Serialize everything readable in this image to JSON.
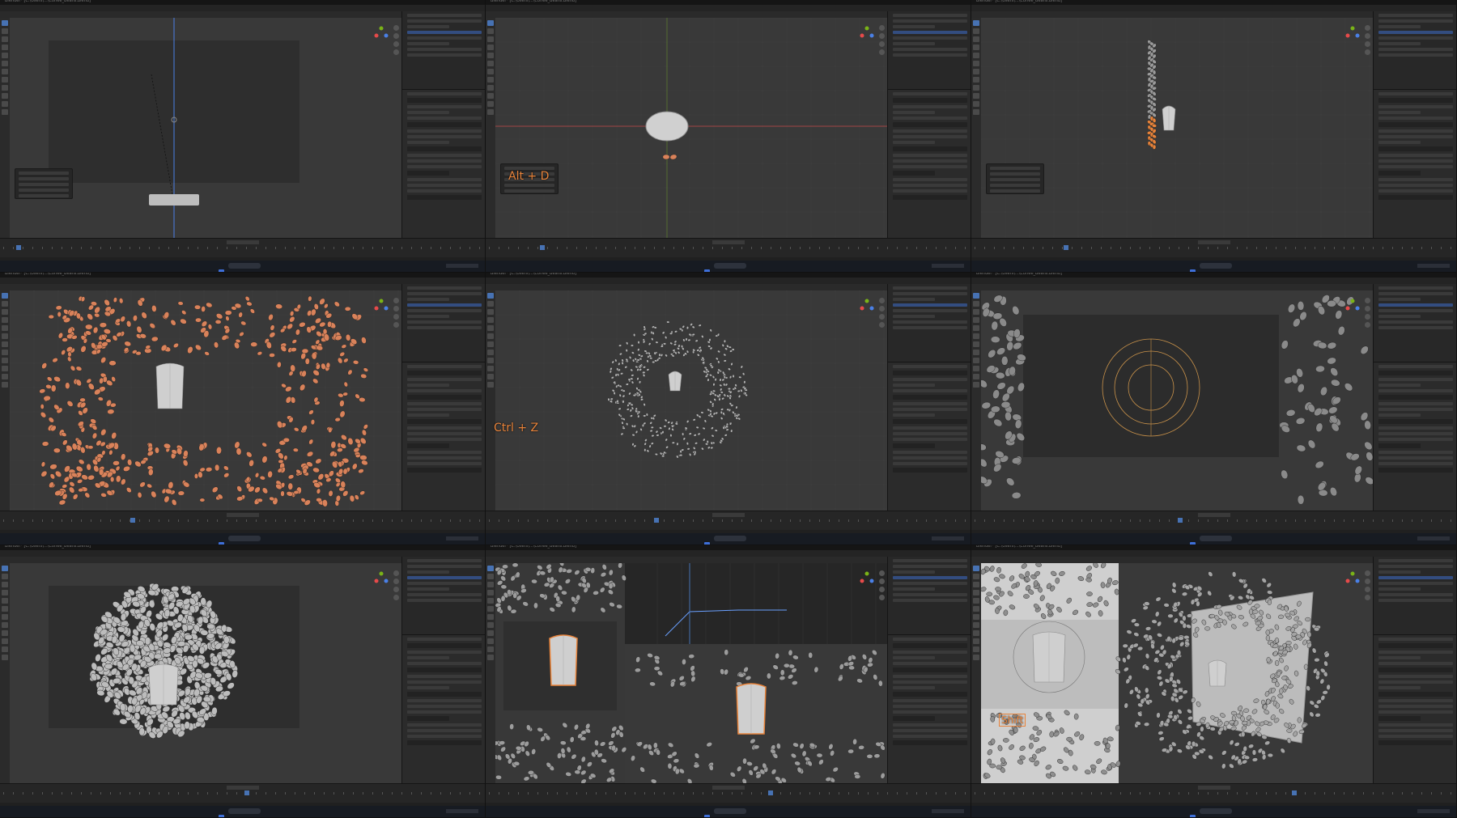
{
  "app": {
    "title_text": "Blender* [C:\\Users\\...\\Coffee_Beans.blend]"
  },
  "menu": [
    "File",
    "Edit",
    "Render",
    "Window",
    "Help"
  ],
  "panels": [
    {
      "id": "p1",
      "title": "Blender* [C:\\Users\\...\\Coffee_Beans.blend]",
      "shortcut": ""
    },
    {
      "id": "p2",
      "title": "Blender* [C:\\Users\\...\\Coffee_Beans.blend]",
      "shortcut": "Alt + D"
    },
    {
      "id": "p3",
      "title": "Blender* [C:\\Users\\...\\Coffee_Beans.blend]",
      "shortcut": ""
    },
    {
      "id": "p4",
      "title": "Blender* [C:\\Users\\...\\Coffee_Beans.blend]",
      "shortcut": ""
    },
    {
      "id": "p5",
      "title": "Blender* [C:\\Users\\...\\Coffee_Beans.blend]",
      "shortcut": "Ctrl + Z"
    },
    {
      "id": "p6",
      "title": "Blender* [C:\\Users\\...\\Coffee_Beans.blend]",
      "shortcut": ""
    },
    {
      "id": "p7",
      "title": "Blender* [C:\\Users\\...\\Coffee_Beans.blend]",
      "shortcut": ""
    },
    {
      "id": "p8",
      "title": "Blender* [C:\\Users\\...\\Coffee_Beans.blend]",
      "shortcut": ""
    },
    {
      "id": "p9",
      "title": "Blender* [C:\\Users\\...\\Coffee_Beans.blend]",
      "shortcut": "Shift"
    }
  ],
  "colors": {
    "accent": "#4772b3",
    "selection_orange": "#e8833a",
    "bean_copper": "#d9825a",
    "bean_gray": "#9a9a9a",
    "viewport": "#393939"
  },
  "icons": [
    "blender-logo-icon",
    "windows-start-icon",
    "search-icon",
    "play-icon",
    "gizmo-axis-icon"
  ]
}
